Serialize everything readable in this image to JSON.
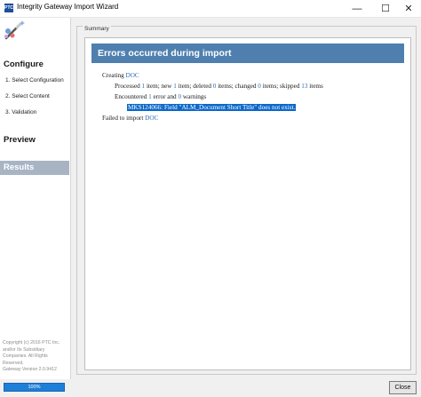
{
  "window": {
    "title": "Integrity Gateway Import Wizard",
    "app_icon_text": "PTC",
    "minimize_glyph": "—",
    "maximize_glyph": "☐",
    "close_glyph": "✕"
  },
  "sidebar": {
    "configure_label": "Configure",
    "steps": [
      "1. Select Configuration",
      "2. Select Content",
      "3. Validation"
    ],
    "preview_label": "Preview",
    "results_label": "Results",
    "copyright_line1": "Copyright (c) 2016 PTC Inc.",
    "copyright_line2": "and/or Its Subsidiary",
    "copyright_line3": "Companies. All Rights",
    "copyright_line4": "Reserved.",
    "version": "Gateway Version 2.0.9412"
  },
  "summary": {
    "group_label": "Summary",
    "header": "Errors occurred during import",
    "creating_prefix": "Creating",
    "doc_name": "DOC",
    "processed_count": "1",
    "new_count": "1",
    "deleted_count": "0",
    "changed_count": "0",
    "skipped_count": "13",
    "stats_processed_label": "Processed",
    "stats_item_new": "item; new",
    "stats_item_deleted": "item; deleted",
    "stats_items_changed": "items; changed",
    "stats_items_skipped": "items; skipped",
    "stats_items_end": "items",
    "encountered_label": "Encountered",
    "error_count": "1",
    "error_word": "error and",
    "warning_count": "0",
    "warnings_word": "warnings",
    "error_message": "MKS124066: Field \"ALM_Document Short Title\" does not exist.",
    "failed_prefix": "Failed to import"
  },
  "footer": {
    "progress_percent": 100,
    "progress_label": "100%",
    "close_label": "Close"
  },
  "colors": {
    "header_bar": "#4e7faf",
    "accent_blue": "#2d6fb8",
    "error_highlight": "#0d68c9",
    "results_selected": "#a8b4c4",
    "progress": "#1e7fd8"
  }
}
